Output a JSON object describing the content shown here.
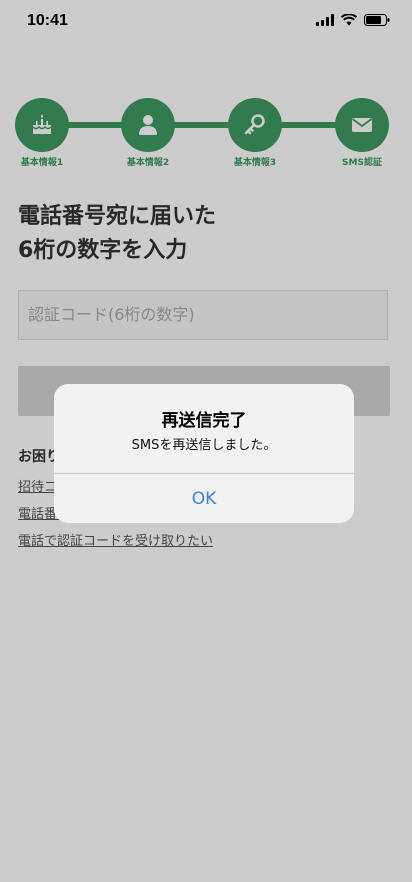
{
  "status_bar": {
    "time": "10:41"
  },
  "stepper": {
    "steps": [
      {
        "label": "基本情報1",
        "icon": "cake-icon"
      },
      {
        "label": "基本情報2",
        "icon": "person-icon"
      },
      {
        "label": "基本情報3",
        "icon": "key-icon"
      },
      {
        "label": "SMS認証",
        "icon": "mail-icon"
      }
    ],
    "color": "#3f9a62"
  },
  "heading": "電話番号宛に届いた\n6桁の数字を入力",
  "code_input": {
    "placeholder": "認証コード(6桁の数字)",
    "value": ""
  },
  "help": {
    "title": "お困りの方",
    "links": [
      "招待コード",
      "電話番号",
      "電話で認証コードを受け取りたい"
    ]
  },
  "alert": {
    "title": "再送信完了",
    "message": "SMSを再送信しました。",
    "ok_label": "OK",
    "ok_color": "#3b7fd9"
  }
}
